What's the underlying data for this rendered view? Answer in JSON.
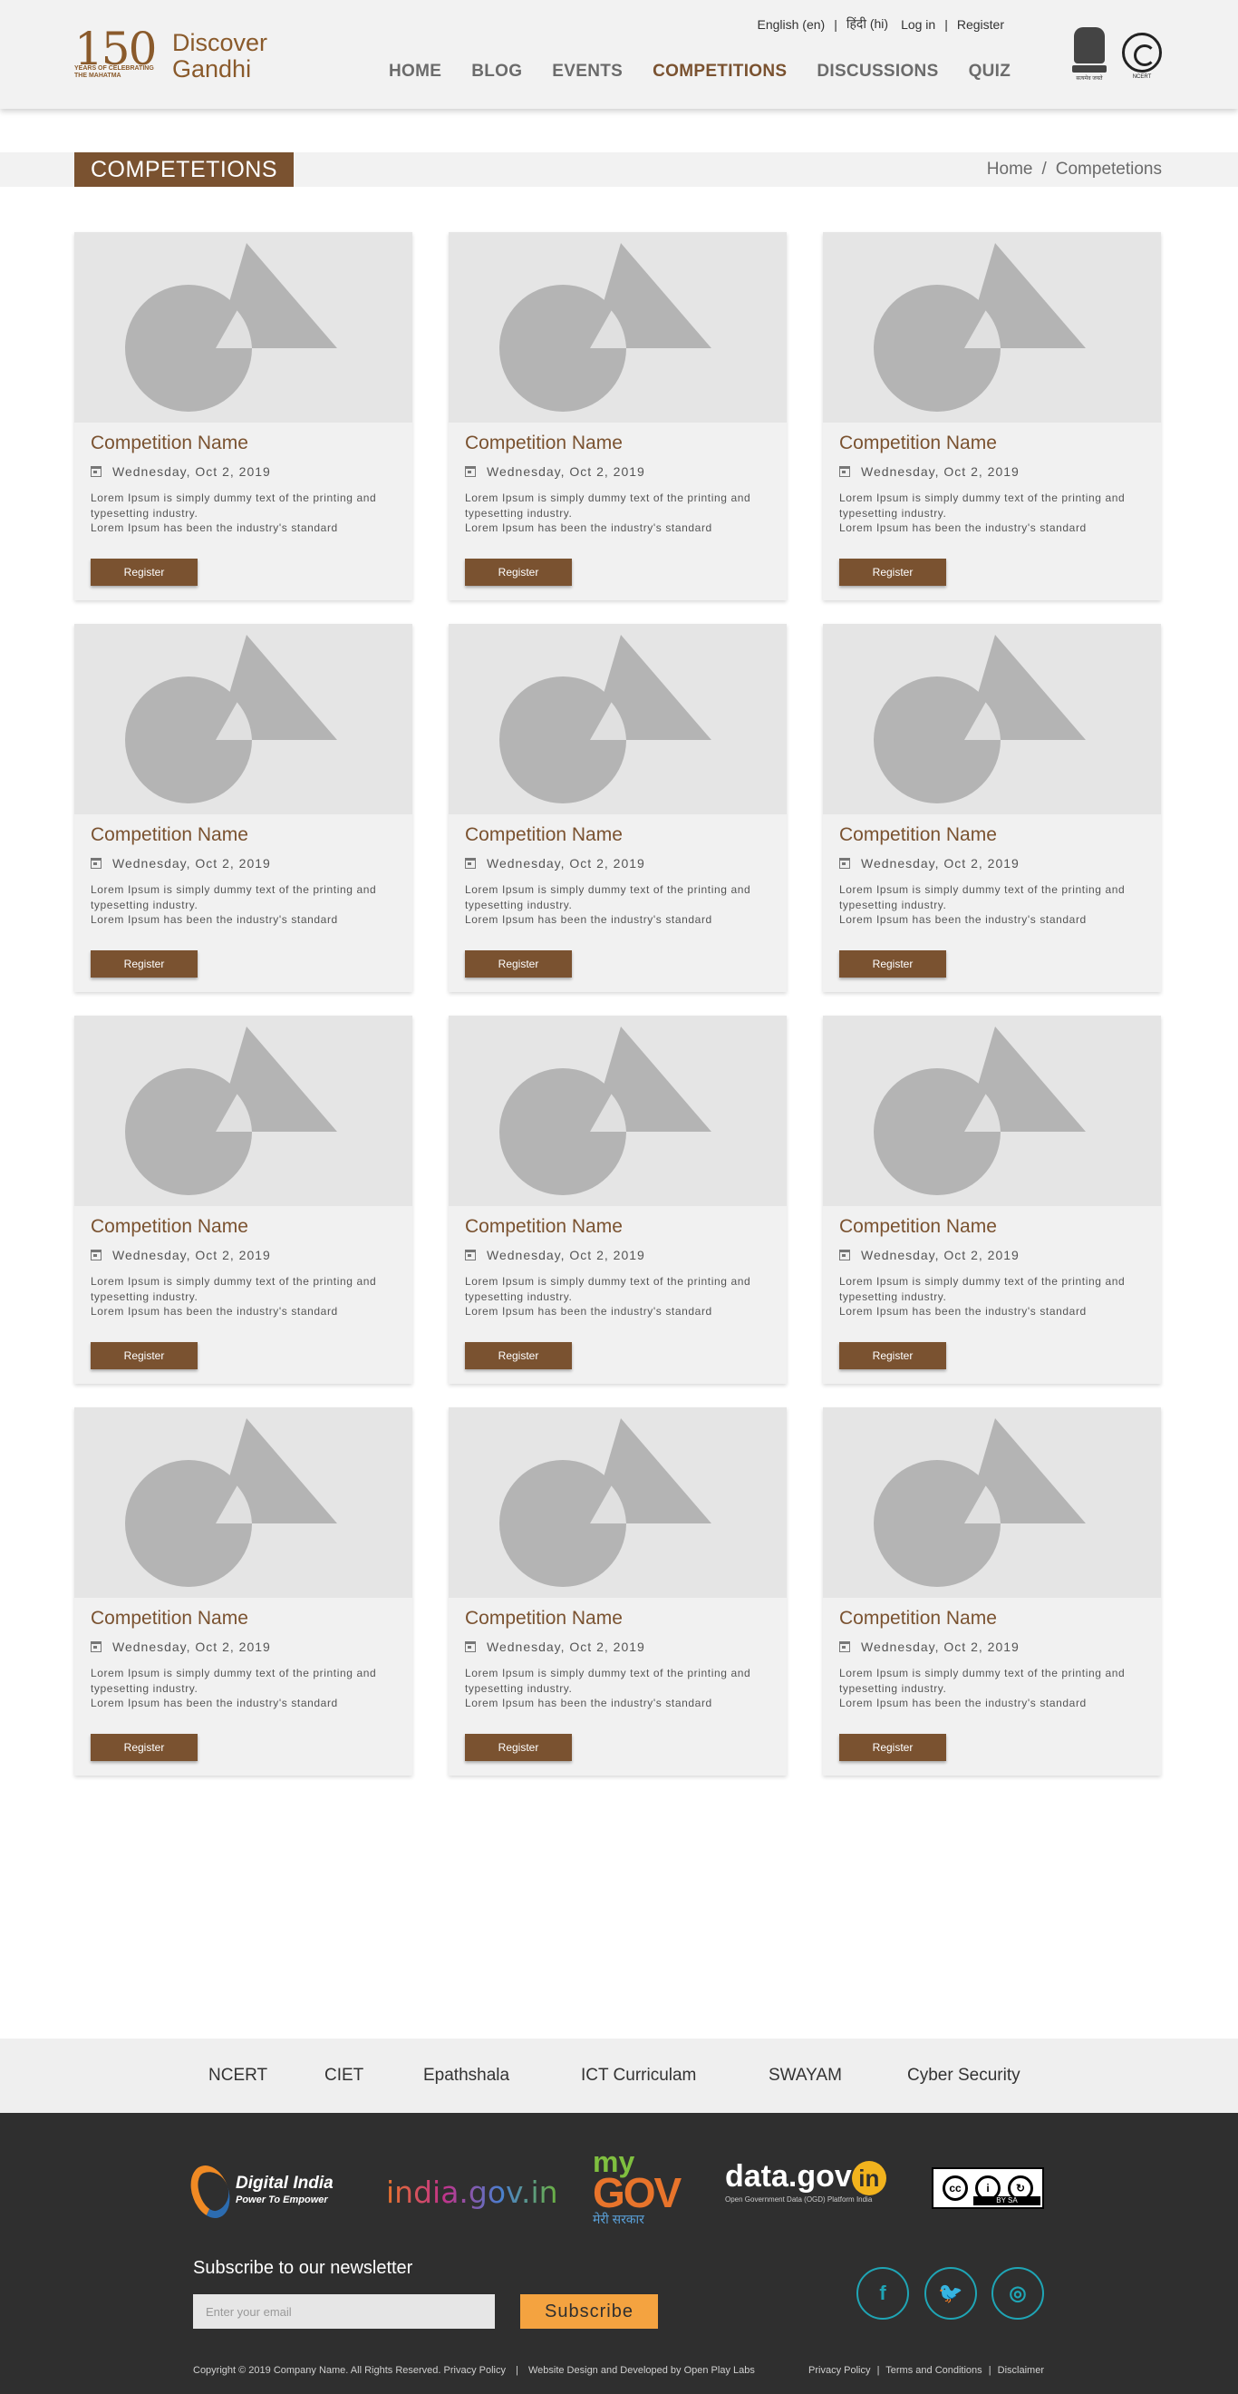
{
  "brand": {
    "mark_number": "150",
    "mark_tagline": "Years of Celebrating the Mahatma",
    "name_line1": "Discover",
    "name_line2": "Gandhi"
  },
  "top_links": {
    "english": "English (en)",
    "hindi": "हिंदी (hi)",
    "login": "Log in",
    "register": "Register",
    "separator": "|"
  },
  "nav": {
    "items": [
      {
        "label": "HOME"
      },
      {
        "label": "BLOG"
      },
      {
        "label": "EVENTS"
      },
      {
        "label": "COMPETITIONS"
      },
      {
        "label": "DISCUSSIONS"
      },
      {
        "label": "QUIZ"
      }
    ],
    "active": "COMPETITIONS"
  },
  "page": {
    "title": "COMPETETIONS",
    "breadcrumb": {
      "home": "Home",
      "separator": "/",
      "current": "Competetions"
    }
  },
  "cards": [
    {
      "title": "Competition Name",
      "date": "Wednesday, Oct 2, 2019",
      "desc": "Lorem Ipsum is simply dummy text of the printing and typesetting industry.\nLorem Ipsum has been the industry's standard",
      "button": "Register"
    },
    {
      "title": "Competition Name",
      "date": "Wednesday, Oct 2, 2019",
      "desc": "Lorem Ipsum is simply dummy text of the printing and typesetting industry.\nLorem Ipsum has been the industry's standard",
      "button": "Register"
    },
    {
      "title": "Competition Name",
      "date": "Wednesday, Oct 2, 2019",
      "desc": "Lorem Ipsum is simply dummy text of the printing and typesetting industry.\nLorem Ipsum has been the industry's standard",
      "button": "Register"
    },
    {
      "title": "Competition Name",
      "date": "Wednesday, Oct 2, 2019",
      "desc": "Lorem Ipsum is simply dummy text of the printing and typesetting industry.\nLorem Ipsum has been the industry's standard",
      "button": "Register"
    },
    {
      "title": "Competition Name",
      "date": "Wednesday, Oct 2, 2019",
      "desc": "Lorem Ipsum is simply dummy text of the printing and typesetting industry.\nLorem Ipsum has been the industry's standard",
      "button": "Register"
    },
    {
      "title": "Competition Name",
      "date": "Wednesday, Oct 2, 2019",
      "desc": "Lorem Ipsum is simply dummy text of the printing and typesetting industry.\nLorem Ipsum has been the industry's standard",
      "button": "Register"
    },
    {
      "title": "Competition Name",
      "date": "Wednesday, Oct 2, 2019",
      "desc": "Lorem Ipsum is simply dummy text of the printing and typesetting industry.\nLorem Ipsum has been the industry's standard",
      "button": "Register"
    },
    {
      "title": "Competition Name",
      "date": "Wednesday, Oct 2, 2019",
      "desc": "Lorem Ipsum is simply dummy text of the printing and typesetting industry.\nLorem Ipsum has been the industry's standard",
      "button": "Register"
    },
    {
      "title": "Competition Name",
      "date": "Wednesday, Oct 2, 2019",
      "desc": "Lorem Ipsum is simply dummy text of the printing and typesetting industry.\nLorem Ipsum has been the industry's standard",
      "button": "Register"
    },
    {
      "title": "Competition Name",
      "date": "Wednesday, Oct 2, 2019",
      "desc": "Lorem Ipsum is simply dummy text of the printing and typesetting industry.\nLorem Ipsum has been the industry's standard",
      "button": "Register"
    },
    {
      "title": "Competition Name",
      "date": "Wednesday, Oct 2, 2019",
      "desc": "Lorem Ipsum is simply dummy text of the printing and typesetting industry.\nLorem Ipsum has been the industry's standard",
      "button": "Register"
    },
    {
      "title": "Competition Name",
      "date": "Wednesday, Oct 2, 2019",
      "desc": "Lorem Ipsum is simply dummy text of the printing and typesetting industry.\nLorem Ipsum has been the industry's standard",
      "button": "Register"
    }
  ],
  "footer_links": [
    "NCERT",
    "CIET",
    "Epathshala",
    "ICT Curriculam",
    "SWAYAM",
    "Cyber Security"
  ],
  "partners": {
    "digital_india": {
      "name": "Digital India",
      "tagline": "Power To Empower"
    },
    "india_gov": "india.gov.in",
    "mygov": {
      "my": "my",
      "gov": "GOV",
      "sub": "मेरी सरकार"
    },
    "data_gov": {
      "main": "data.gov",
      "in": "in",
      "sub": "Open Government Data (OGD) Platform India"
    },
    "cc": {
      "label": "BY   SA"
    }
  },
  "newsletter": {
    "title": "Subscribe to our newsletter",
    "placeholder": "Enter your email",
    "button": "Subscribe"
  },
  "social": [
    {
      "icon": "facebook-icon",
      "glyph": "f"
    },
    {
      "icon": "twitter-icon",
      "glyph": "🐦"
    },
    {
      "icon": "instagram-icon",
      "glyph": "◎"
    }
  ],
  "copyright": {
    "text": "Copyright © 2019 Company Name. All Rights Reserved.",
    "privacy": "Privacy Policy",
    "separator": "|",
    "credit": "Website Design and Developed by Open Play Labs"
  },
  "legal": {
    "privacy": "Privacy Policy",
    "terms": "Terms and Conditions",
    "disclaimer": "Disclaimer",
    "separator": "|"
  },
  "colors": {
    "brand_brown": "#7a5230",
    "subscribe_orange": "#f4a340",
    "social_teal": "#1fa5b5",
    "footer_dark": "#2f2f2f"
  }
}
